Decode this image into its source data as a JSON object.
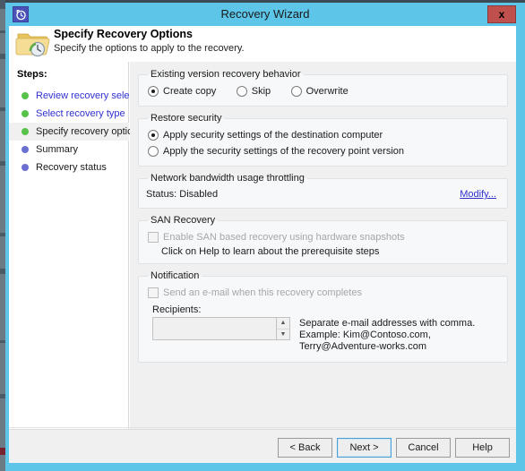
{
  "window": {
    "title": "Recovery Wizard",
    "app_icon": "history-clock-icon",
    "close_label": "x"
  },
  "header": {
    "icon": "folder-clock-icon",
    "title": "Specify Recovery Options",
    "subtitle": "Specify the options to apply to the recovery."
  },
  "sidebar": {
    "heading": "Steps:",
    "items": [
      {
        "label": "Review recovery selection",
        "state": "done"
      },
      {
        "label": "Select recovery type",
        "state": "done"
      },
      {
        "label": "Specify recovery options",
        "state": "current"
      },
      {
        "label": "Summary",
        "state": "future"
      },
      {
        "label": "Recovery status",
        "state": "future"
      }
    ]
  },
  "main": {
    "existing_version": {
      "legend": "Existing version recovery behavior",
      "options": [
        {
          "label": "Create copy",
          "checked": true
        },
        {
          "label": "Skip",
          "checked": false
        },
        {
          "label": "Overwrite",
          "checked": false
        }
      ]
    },
    "restore_security": {
      "legend": "Restore security",
      "options": [
        {
          "label": "Apply security settings of the destination computer",
          "checked": true
        },
        {
          "label": "Apply the security settings of the recovery point version",
          "checked": false
        }
      ]
    },
    "bandwidth": {
      "legend": "Network bandwidth usage throttling",
      "status_label": "Status: Disabled",
      "modify_link": "Modify..."
    },
    "san": {
      "legend": "SAN Recovery",
      "checkbox_label": "Enable SAN based recovery using hardware snapshots",
      "checkbox_checked": false,
      "checkbox_disabled": true,
      "note": "Click on Help to learn about the prerequisite steps"
    },
    "notification": {
      "legend": "Notification",
      "checkbox_label": "Send an e-mail when this recovery completes",
      "checkbox_checked": false,
      "checkbox_disabled": true,
      "recipients_label": "Recipients:",
      "recipients_value": "",
      "recipients_placeholder": "",
      "hint_line1": "Separate e-mail addresses with comma.",
      "hint_line2": "Example: Kim@Contoso.com, Terry@Adventure-works.com"
    }
  },
  "footer": {
    "back": "< Back",
    "next": "Next >",
    "cancel": "Cancel",
    "help": "Help"
  },
  "colors": {
    "title_bar": "#5cc5e8",
    "close_button": "#c0504d",
    "link": "#3030d0",
    "step_done": "#59c24a",
    "step_future": "#6b6fd0",
    "panel": "#f0f0f0"
  }
}
